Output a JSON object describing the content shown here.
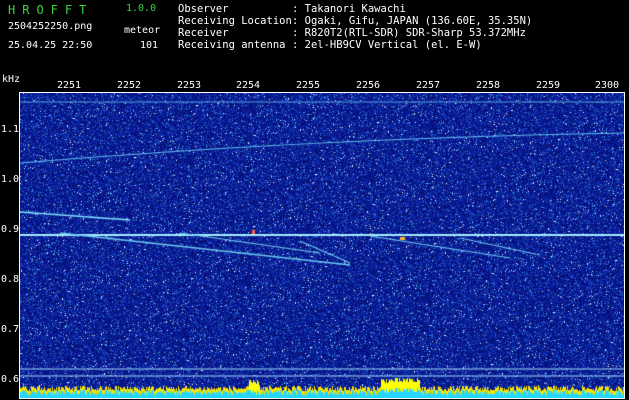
{
  "header": {
    "logo": "HROFFT",
    "version": "1.0.0",
    "filename": "2504252250.png",
    "meteor_label": "meteor",
    "datetime": "25.04.25 22:50",
    "meteor_count": "101"
  },
  "info": [
    {
      "key": "Observer",
      "value": ": Takanori Kawachi"
    },
    {
      "key": "Receiving Location",
      "value": ": Ogaki, Gifu, JAPAN (136.60E, 35.35N)"
    },
    {
      "key": "Receiver",
      "value": ": R820T2(RTL-SDR) SDR-Sharp 53.372MHz"
    },
    {
      "key": "Receiving antenna",
      "value": ": 2el-HB9CV Vertical (el. E-W)"
    }
  ],
  "axis": {
    "y_unit": "kHz",
    "y_ticks": [
      "1.1",
      "1.0",
      "0.9",
      "0.8",
      "0.7",
      "0.6"
    ],
    "x_ticks": [
      "2251",
      "2252",
      "2253",
      "2254",
      "2255",
      "2256",
      "2257",
      "2258",
      "2259",
      "2300"
    ]
  },
  "colors": {
    "background": "#000000",
    "spectrum_base": "#0a1a8c",
    "trace": "#7ad7ff",
    "carrier": "#9fe8ff",
    "bottom_bar": "#27d6ff",
    "bottom_peak": "#ffff00"
  }
}
